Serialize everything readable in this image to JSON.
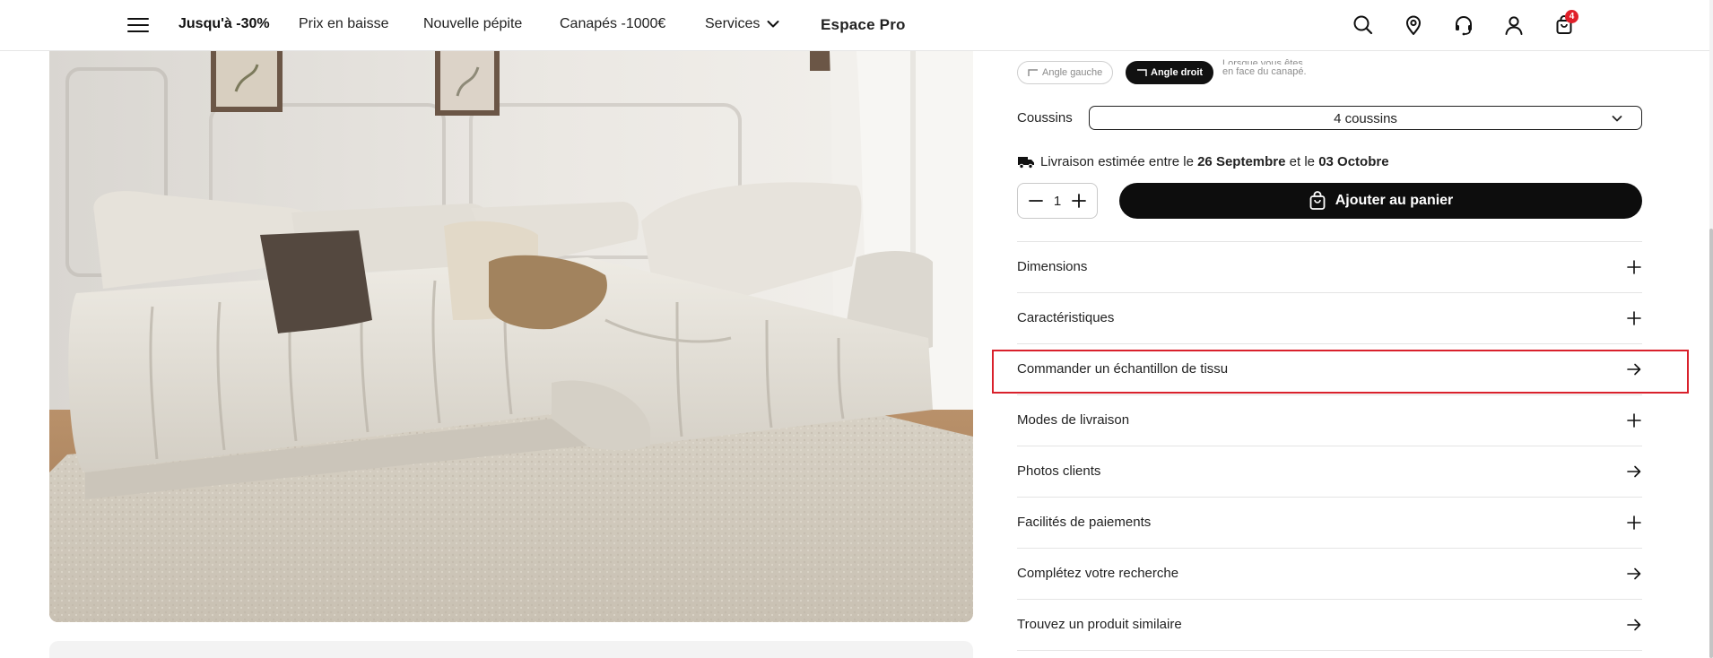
{
  "header": {
    "nav": {
      "promo": "Jusqu'à -30%",
      "price_drop": "Prix en baisse",
      "new_gem": "Nouvelle pépite",
      "sofas": "Canapés -1000€",
      "services": "Services",
      "pro": "Espace Pro"
    },
    "icons": [
      "menu-icon",
      "search-icon",
      "location-pin-icon",
      "headset-icon",
      "user-icon",
      "shopping-bag-icon"
    ],
    "cart_count": "4"
  },
  "product": {
    "image_alt": "Canapé d'angle beige en tissu bouclé avec tapis moelleux",
    "orientation": {
      "left_label": "Angle gauche",
      "right_label": "Angle droit",
      "selected": "Angle droit",
      "note_line1": "Lorsque vous êtes",
      "note_line2": "en face du canapé."
    },
    "cushions": {
      "label": "Coussins",
      "value": "4 coussins"
    },
    "delivery": {
      "prefix": "Livraison estimée entre le",
      "date_from": "26 Septembre",
      "middle": "et le",
      "date_to": "03 Octobre"
    },
    "quantity": "1",
    "add_to_cart": "Ajouter au panier",
    "accordion": [
      {
        "label": "Dimensions",
        "icon": "plus-icon"
      },
      {
        "label": "Caractéristiques",
        "icon": "plus-icon"
      },
      {
        "label": "Commander un échantillon de tissu",
        "icon": "arrow-right-icon"
      },
      {
        "label": "Modes de livraison",
        "icon": "plus-icon"
      },
      {
        "label": "Photos clients",
        "icon": "arrow-right-icon"
      },
      {
        "label": "Facilités de paiements",
        "icon": "plus-icon"
      },
      {
        "label": "Complétez votre recherche",
        "icon": "arrow-right-icon"
      },
      {
        "label": "Trouvez un produit similaire",
        "icon": "arrow-right-icon"
      }
    ]
  },
  "colors": {
    "accent": "#0d0d0d",
    "badge": "#e0202a",
    "highlight": "#d9212c"
  }
}
